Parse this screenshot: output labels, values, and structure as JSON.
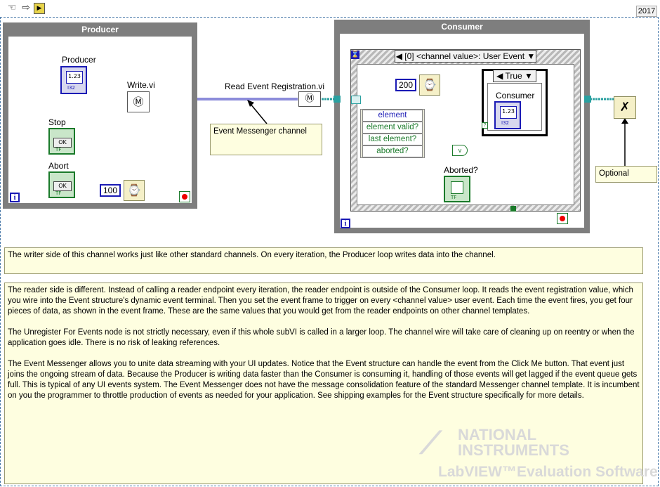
{
  "toolbar": {
    "version": "2017",
    "icons": [
      "hand-icon",
      "arrow-icon",
      "run-icon"
    ]
  },
  "producer": {
    "title": "Producer",
    "indicator_label": "Producer",
    "indicator_type": "I32",
    "write_label": "Write.vi",
    "stop_label": "Stop",
    "abort_label": "Abort",
    "button_text": "OK",
    "bool_tag": "TF",
    "wait_value": "100",
    "iteration": "i"
  },
  "wire": {
    "read_label": "Read Event Registration.vi",
    "channel_comment": "Event Messenger channel"
  },
  "consumer": {
    "title": "Consumer",
    "event_selector": "[0] <channel value>: User Event",
    "timeout": "200",
    "case_selector": "True",
    "indicator_label": "Consumer",
    "indicator_type": "I32",
    "event_data": [
      "element",
      "element valid?",
      "last element?",
      "aborted?"
    ],
    "aborted_label": "Aborted?",
    "bool_tag": "TF",
    "iteration": "i"
  },
  "unregister": {
    "comment": "Optional"
  },
  "comments": {
    "first": "The writer side of this channel works just like other standard channels. On every iteration, the Producer loop writes data into the channel.",
    "second": [
      "The reader side is different. Instead of calling a reader endpoint every iteration, the reader endpoint is outside of the Consumer loop. It reads the event registration value, which you wire into the Event structure's dynamic event terminal. Then you set the event frame to trigger on every <channel value> user event.  Each time the event fires, you get four pieces of data, as shown in the event frame. These are the same values that you would get from the reader endpoints on other channel templates.",
      "The Unregister For Events node is not strictly necessary, even if this whole subVI is called in a larger loop. The channel wire will take care of cleaning up on reentry or when the application goes idle. There is no risk of leaking references.",
      "The Event Messenger allows you to unite data streaming with your UI updates. Notice that the Event structure can handle the event from the Click Me button. That event just joins the ongoing stream of data. Because the Producer is writing data faster than the Consumer is consuming it, handling of those events will get lagged if the event queue gets full. This is typical of any UI events system. The Event Messenger does not have the message consolidation feature of the standard Messenger channel template. It is incumbent on you the programmer to throttle production of events as needed for your application. See shipping examples for the Event structure specifically for more details."
    ]
  },
  "watermark": {
    "line1": "NATIONAL",
    "line2": "INSTRUMENTS",
    "line3": "LabVIEW™Evaluation Software"
  },
  "colors": {
    "loop_frame": "#7e7e7e",
    "numeric_wire": "#1a1ab5",
    "boolean_wire": "#1a7a2a",
    "channel_wire": "#2aa0a0",
    "comment_bg": "#fefee0"
  }
}
